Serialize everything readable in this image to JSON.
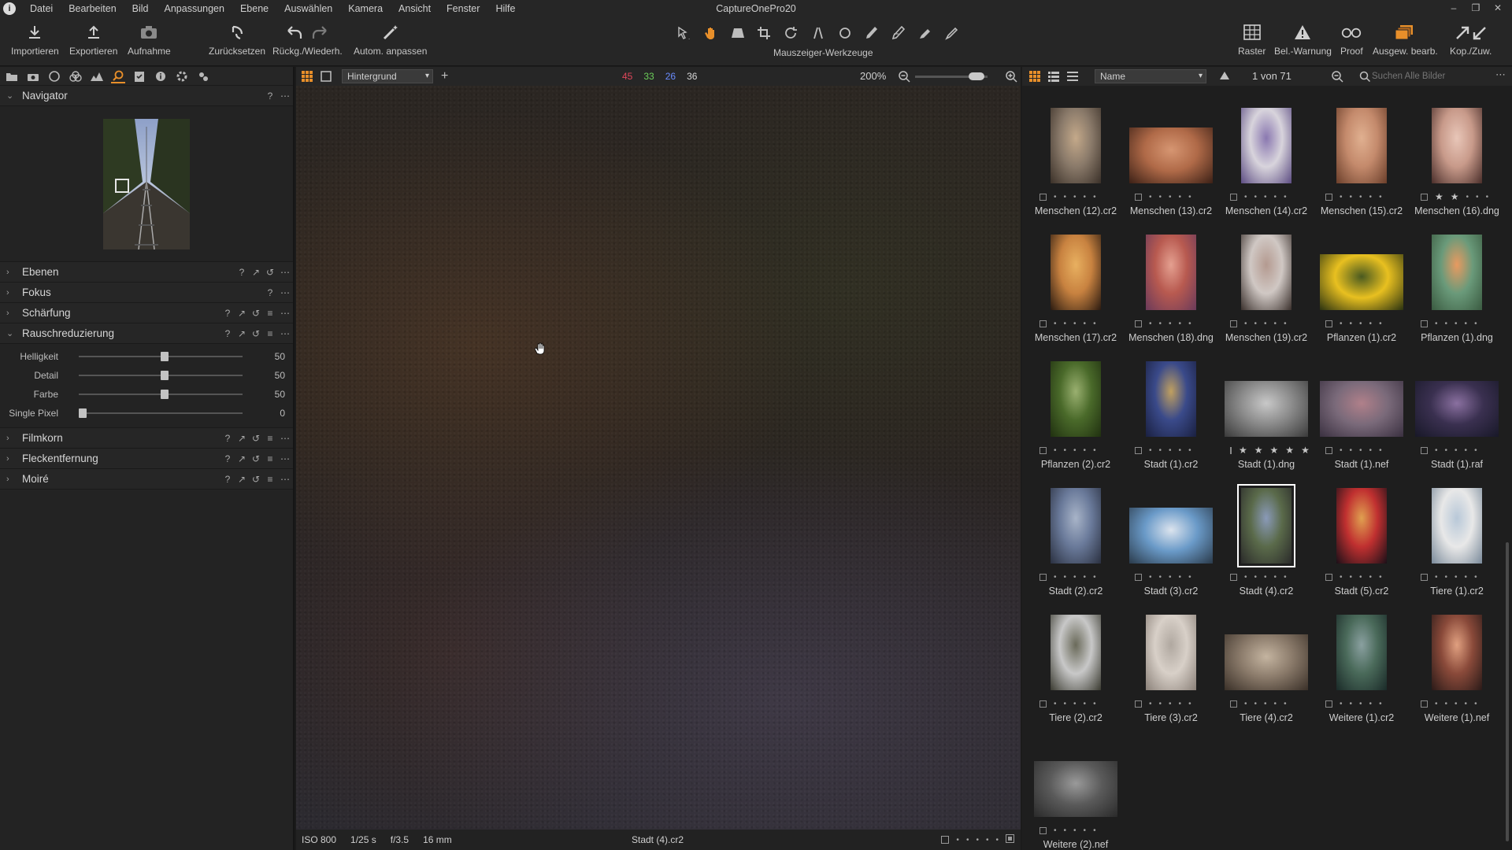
{
  "app": {
    "title": "CaptureOnePro20"
  },
  "menu": [
    "Datei",
    "Bearbeiten",
    "Bild",
    "Anpassungen",
    "Ebene",
    "Auswählen",
    "Kamera",
    "Ansicht",
    "Fenster",
    "Hilfe"
  ],
  "toolbar": {
    "import_label": "Importieren",
    "export_label": "Exportieren",
    "capture_label": "Aufnahme",
    "reset_label": "Zurücksetzen",
    "undo_label": "Rückg./Wiederh.",
    "auto_label": "Autom. anpassen",
    "cursor_tools_label": "Mauszeiger-Werkzeuge",
    "grid_label": "Raster",
    "exposure_warning_label": "Bel.-Warnung",
    "proof_label": "Proof",
    "edit_selected_label": "Ausgew. bearb.",
    "copy_apply_label": "Kop./Zuw."
  },
  "left_panel": {
    "navigator": {
      "title": "Navigator"
    },
    "sections": [
      {
        "id": "ebenen",
        "title": "Ebenen",
        "expanded": false
      },
      {
        "id": "fokus",
        "title": "Fokus",
        "expanded": false
      },
      {
        "id": "schaerfung",
        "title": "Schärfung",
        "expanded": false
      },
      {
        "id": "rauschreduzierung",
        "title": "Rauschreduzierung",
        "expanded": true
      },
      {
        "id": "filmkorn",
        "title": "Filmkorn",
        "expanded": false
      },
      {
        "id": "fleckentfernung",
        "title": "Fleckentfernung",
        "expanded": false
      },
      {
        "id": "moire",
        "title": "Moiré",
        "expanded": false
      }
    ],
    "noise_sliders": [
      {
        "label": "Helligkeit",
        "value": 50,
        "max": 100
      },
      {
        "label": "Detail",
        "value": 50,
        "max": 100
      },
      {
        "label": "Farbe",
        "value": 50,
        "max": 100
      },
      {
        "label": "Single Pixel",
        "value": 0,
        "max": 100
      }
    ]
  },
  "viewer": {
    "layer": "Hintergrund",
    "rgb": {
      "r": "45",
      "g": "33",
      "b": "26",
      "l": "36"
    },
    "zoom": "200%",
    "zoom_level": 0.85
  },
  "statusbar": {
    "iso": "ISO 800",
    "shutter": "1/25 s",
    "aperture": "f/3.5",
    "focal_length": "16 mm",
    "filename": "Stadt (4).cr2"
  },
  "browser": {
    "sort": "Name",
    "count": "1 von 71",
    "search_placeholder": "Suchen Alle Bilder",
    "selected": "Stadt (4).cr2",
    "items": [
      {
        "name": "Menschen (12).cr2",
        "stars": 0,
        "orient": "portrait",
        "colors": [
          "#8a7a6a",
          "#c4a98a",
          "#3a3028"
        ]
      },
      {
        "name": "Menschen (13).cr2",
        "stars": 0,
        "orient": "landscape",
        "colors": [
          "#b06a48",
          "#d69672",
          "#3b2016"
        ]
      },
      {
        "name": "Menschen (14).cr2",
        "stars": 0,
        "orient": "portrait",
        "colors": [
          "#d8d4dc",
          "#8a78b0",
          "#5c4c82"
        ]
      },
      {
        "name": "Menschen (15).cr2",
        "stars": 0,
        "orient": "portrait",
        "colors": [
          "#c48a6c",
          "#e0b090",
          "#6a3e2a"
        ]
      },
      {
        "name": "Menschen (16).dng",
        "stars": 2,
        "orient": "portrait",
        "colors": [
          "#c89a8a",
          "#e8c6b8",
          "#4a2e2a"
        ]
      },
      {
        "name": "Menschen (17).cr2",
        "stars": 0,
        "orient": "portrait",
        "colors": [
          "#c88240",
          "#e8b060",
          "#2a1a10"
        ]
      },
      {
        "name": "Menschen (18).dng",
        "stars": 0,
        "orient": "portrait",
        "colors": [
          "#b85a50",
          "#e4a090",
          "#6a3a5a"
        ]
      },
      {
        "name": "Menschen (19).cr2",
        "stars": 0,
        "orient": "portrait",
        "colors": [
          "#d0c8c4",
          "#b49a90",
          "#3a302c"
        ]
      },
      {
        "name": "Pflanzen (1).cr2",
        "stars": 0,
        "orient": "landscape",
        "colors": [
          "#e8c020",
          "#4a5a20",
          "#2a3210"
        ]
      },
      {
        "name": "Pflanzen (1).dng",
        "stars": 0,
        "orient": "portrait",
        "colors": [
          "#6a9a7a",
          "#e89a60",
          "#3a5a40"
        ]
      },
      {
        "name": "Pflanzen (2).cr2",
        "stars": 0,
        "orient": "portrait",
        "colors": [
          "#4a6a2a",
          "#9ab070",
          "#203010"
        ]
      },
      {
        "name": "Stadt (1).cr2",
        "stars": 0,
        "orient": "portrait",
        "colors": [
          "#3a4a8a",
          "#c0a060",
          "#1a2040"
        ]
      },
      {
        "name": "Stadt (1).dng",
        "stars": 5,
        "orient": "landscape",
        "colors": [
          "#8a8a8a",
          "#c8c8c8",
          "#3a3a3a"
        ]
      },
      {
        "name": "Stadt (1).nef",
        "stars": 0,
        "orient": "landscape",
        "colors": [
          "#7a6a7a",
          "#b0808a",
          "#3a3040"
        ]
      },
      {
        "name": "Stadt (1).raf",
        "stars": 0,
        "orient": "landscape",
        "colors": [
          "#3a3050",
          "#8a70a0",
          "#181828"
        ]
      },
      {
        "name": "Stadt (2).cr2",
        "stars": 0,
        "orient": "portrait",
        "colors": [
          "#6a7a9a",
          "#a8b4c8",
          "#2a3040"
        ]
      },
      {
        "name": "Stadt (3).cr2",
        "stars": 0,
        "orient": "landscape",
        "colors": [
          "#6a9ac8",
          "#dce4ee",
          "#2a3a4a"
        ]
      },
      {
        "name": "Stadt (4).cr2",
        "stars": 0,
        "orient": "portrait",
        "colors": [
          "#5a6a4a",
          "#8a9ab8",
          "#2a2a2a"
        ]
      },
      {
        "name": "Stadt (5).cr2",
        "stars": 0,
        "orient": "portrait",
        "colors": [
          "#c03030",
          "#e0a050",
          "#1a1018"
        ]
      },
      {
        "name": "Tiere (1).cr2",
        "stars": 0,
        "orient": "portrait",
        "colors": [
          "#e8e8e8",
          "#b8c8d8",
          "#7a8a9a"
        ]
      },
      {
        "name": "Tiere (2).cr2",
        "stars": 0,
        "orient": "portrait",
        "colors": [
          "#c8c8c8",
          "#6a6a5a",
          "#3a3a30"
        ]
      },
      {
        "name": "Tiere (3).cr2",
        "stars": 0,
        "orient": "portrait",
        "colors": [
          "#d8d0c8",
          "#b0a8a0",
          "#8a8078"
        ]
      },
      {
        "name": "Tiere (4).cr2",
        "stars": 0,
        "orient": "landscape",
        "colors": [
          "#8a7a6a",
          "#c4b4a0",
          "#3a3028"
        ]
      },
      {
        "name": "Weitere (1).cr2",
        "stars": 0,
        "orient": "portrait",
        "colors": [
          "#4a6a5a",
          "#8aa0a0",
          "#1a2a28"
        ]
      },
      {
        "name": "Weitere (1).nef",
        "stars": 0,
        "orient": "portrait",
        "colors": [
          "#8a4a3a",
          "#e0a080",
          "#2a1a18"
        ]
      },
      {
        "name": "Weitere (2).nef",
        "stars": 0,
        "orient": "landscape",
        "colors": [
          "#5a5a5a",
          "#9a9a9a",
          "#2a2a2a"
        ]
      }
    ]
  },
  "colors": {
    "accent": "#e88f2a",
    "red_readout": "#e0475a",
    "green_readout": "#6ccf5a",
    "blue_readout": "#6a8cff"
  }
}
